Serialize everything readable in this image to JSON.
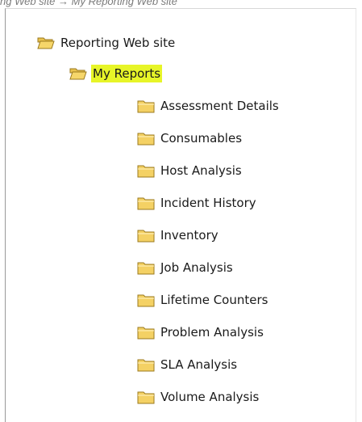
{
  "caption": "ng Web site → My Reporting Web site",
  "colors": {
    "highlight": "#e7f528",
    "folder_fill": "#f6d66a",
    "folder_stroke": "#9b7a1e"
  },
  "tree": {
    "root": {
      "label": "Reporting Web site",
      "icon": "folder-open-icon"
    },
    "group": {
      "label": "My Reports",
      "icon": "folder-open-icon",
      "selected": true
    },
    "items": [
      {
        "label": "Assessment Details",
        "icon": "folder-icon"
      },
      {
        "label": "Consumables",
        "icon": "folder-icon"
      },
      {
        "label": "Host Analysis",
        "icon": "folder-icon"
      },
      {
        "label": "Incident History",
        "icon": "folder-icon"
      },
      {
        "label": "Inventory",
        "icon": "folder-icon"
      },
      {
        "label": "Job Analysis",
        "icon": "folder-icon"
      },
      {
        "label": "Lifetime Counters",
        "icon": "folder-icon"
      },
      {
        "label": "Problem Analysis",
        "icon": "folder-icon"
      },
      {
        "label": "SLA Analysis",
        "icon": "folder-icon"
      },
      {
        "label": "Volume Analysis",
        "icon": "folder-icon"
      }
    ]
  }
}
